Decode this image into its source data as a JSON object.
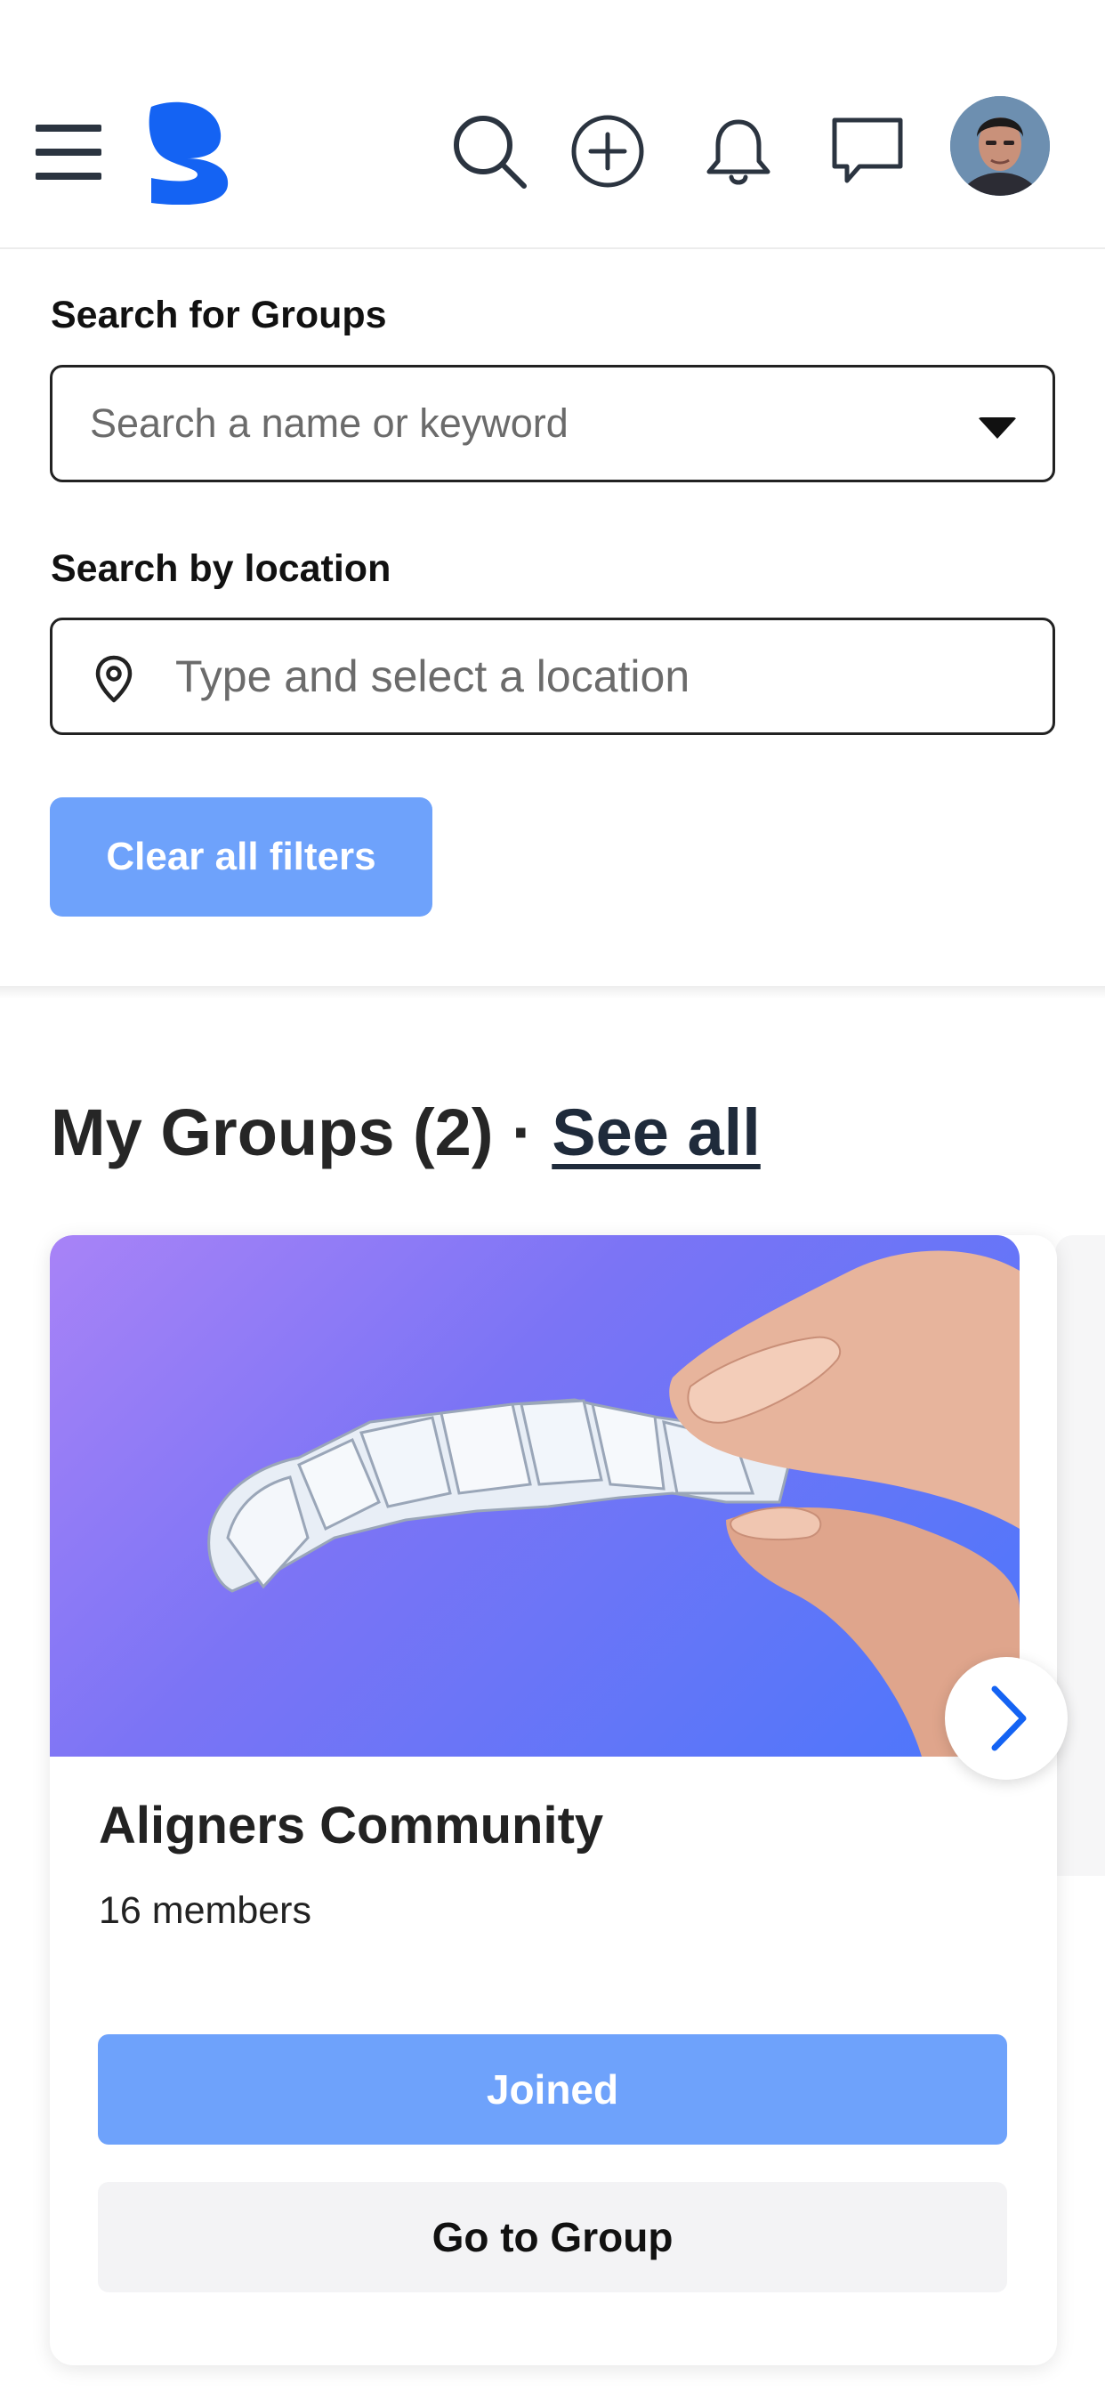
{
  "header": {
    "menu_icon": "hamburger-menu-icon",
    "logo_icon": "brand-s-logo",
    "search_icon": "search-icon",
    "create_icon": "plus-circle-icon",
    "notifications_icon": "bell-icon",
    "messages_icon": "chat-bubble-icon",
    "avatar_icon": "user-avatar",
    "brand_color": "#1463f3"
  },
  "filters": {
    "groups_label": "Search for Groups",
    "groups_placeholder": "Search a name or keyword",
    "location_label": "Search by location",
    "location_placeholder": "Type and select a location",
    "clear_label": "Clear all filters"
  },
  "my_groups": {
    "title": "My Groups (2)",
    "separator": "·",
    "see_all": "See all",
    "cards": [
      {
        "name": "Aligners Community",
        "members": "16 members",
        "joined_label": "Joined",
        "goto_label": "Go to Group",
        "image_icon": "clear-aligner-photo"
      }
    ]
  },
  "colors": {
    "primary_button": "#6ea2fb",
    "secondary_button": "#f3f3f5",
    "accent_arrow": "#1463f3"
  }
}
